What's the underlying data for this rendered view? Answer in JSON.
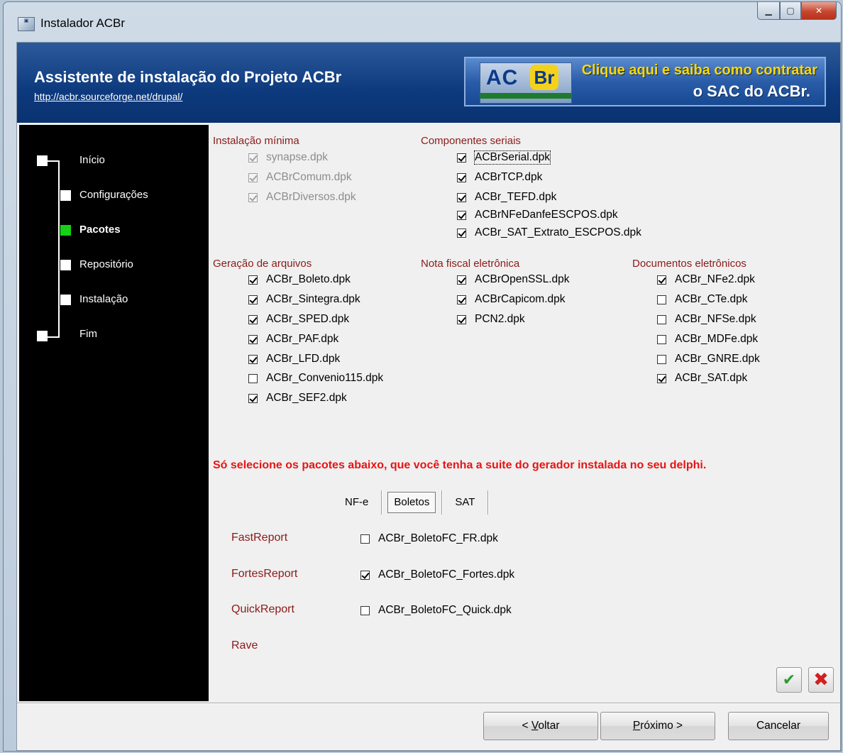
{
  "window": {
    "title": "Instalador ACBr",
    "icon": "installer-icon"
  },
  "header": {
    "title": "Assistente de instalação do Projeto ACBr",
    "link": "http://acbr.sourceforge.net/drupal/",
    "banner_logo_text": "ACBr",
    "banner_line1": "Clique aqui e saiba como contratar",
    "banner_line2": "o SAC do ACBr."
  },
  "steps": [
    {
      "label": "Início",
      "active": false,
      "current": false
    },
    {
      "label": "Configurações",
      "active": false,
      "current": false
    },
    {
      "label": "Pacotes",
      "active": true,
      "current": true
    },
    {
      "label": "Repositório",
      "active": false,
      "current": false
    },
    {
      "label": "Instalação",
      "active": false,
      "current": false
    },
    {
      "label": "Fim",
      "active": false,
      "current": false
    }
  ],
  "groups": {
    "instalacao_minima": {
      "title": "Instalação mínima",
      "items": [
        {
          "label": "synapse.dpk",
          "checked": true,
          "disabled": true
        },
        {
          "label": "ACBrComum.dpk",
          "checked": true,
          "disabled": true
        },
        {
          "label": "ACBrDiversos.dpk",
          "checked": true,
          "disabled": true
        }
      ]
    },
    "componentes_seriais": {
      "title": "Componentes seriais",
      "items": [
        {
          "label": "ACBrSerial.dpk",
          "checked": true
        },
        {
          "label": "ACBrTCP.dpk",
          "checked": true
        },
        {
          "label": "ACBr_TEFD.dpk",
          "checked": true
        },
        {
          "label": "ACBrNFeDanfeESCPOS.dpk",
          "checked": true
        },
        {
          "label": "ACBr_SAT_Extrato_ESCPOS.dpk",
          "checked": true
        }
      ]
    },
    "geracao_arquivos": {
      "title": "Geração de arquivos",
      "items": [
        {
          "label": "ACBr_Boleto.dpk",
          "checked": true
        },
        {
          "label": "ACBr_Sintegra.dpk",
          "checked": true
        },
        {
          "label": "ACBr_SPED.dpk",
          "checked": true
        },
        {
          "label": "ACBr_PAF.dpk",
          "checked": true
        },
        {
          "label": "ACBr_LFD.dpk",
          "checked": true
        },
        {
          "label": "ACBr_Convenio115.dpk",
          "checked": false
        },
        {
          "label": "ACBr_SEF2.dpk",
          "checked": true
        }
      ]
    },
    "nota_fiscal": {
      "title": "Nota fiscal eletrônica",
      "items": [
        {
          "label": "ACBrOpenSSL.dpk",
          "checked": true
        },
        {
          "label": "ACBrCapicom.dpk",
          "checked": true
        },
        {
          "label": "PCN2.dpk",
          "checked": true
        }
      ]
    },
    "documentos": {
      "title": "Documentos eletrônicos",
      "items": [
        {
          "label": "ACBr_NFe2.dpk",
          "checked": true
        },
        {
          "label": "ACBr_CTe.dpk",
          "checked": false
        },
        {
          "label": "ACBr_NFSe.dpk",
          "checked": false
        },
        {
          "label": "ACBr_MDFe.dpk",
          "checked": false
        },
        {
          "label": "ACBr_GNRE.dpk",
          "checked": false
        },
        {
          "label": "ACBr_SAT.dpk",
          "checked": true
        }
      ]
    }
  },
  "warning": "Só selecione os pacotes abaixo, que você tenha a suite do gerador instalada no seu delphi.",
  "tabs": [
    {
      "label": "NF-e",
      "active": false
    },
    {
      "label": "Boletos",
      "active": true
    },
    {
      "label": "SAT",
      "active": false
    }
  ],
  "reports": [
    {
      "label": "FastReport",
      "package": "ACBr_BoletoFC_FR.dpk",
      "checked": false
    },
    {
      "label": "FortesReport",
      "package": "ACBr_BoletoFC_Fortes.dpk",
      "checked": true
    },
    {
      "label": "QuickReport",
      "package": "ACBr_BoletoFC_Quick.dpk",
      "checked": false
    },
    {
      "label": "Rave",
      "package": "",
      "checked": false
    }
  ],
  "buttons": {
    "voltar_prefix": "< ",
    "voltar_hotkey": "V",
    "voltar_rest": "oltar",
    "proximo_hotkey": "P",
    "proximo_rest": "róximo >",
    "cancelar": "Cancelar"
  },
  "mini_buttons": {
    "ok_icon": "checkmark-icon",
    "cancel_icon": "x-icon"
  }
}
